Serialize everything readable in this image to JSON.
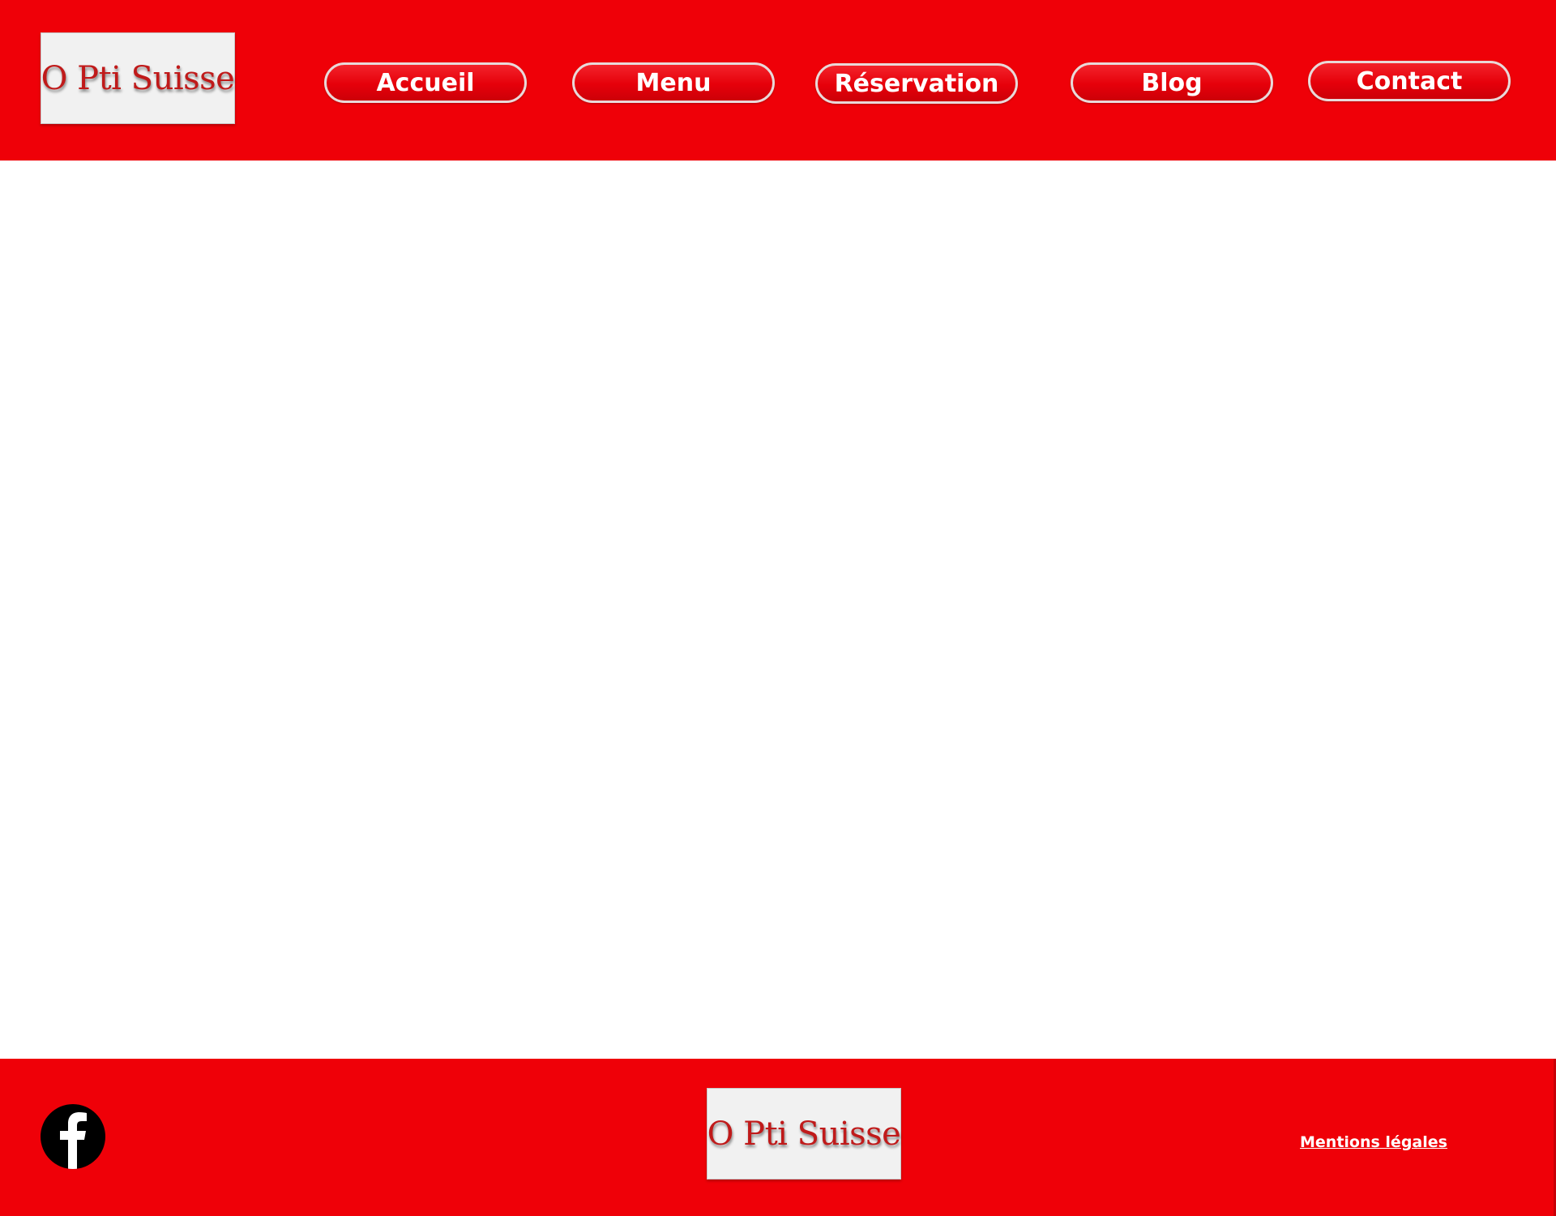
{
  "brand": {
    "name": "O Pti Suisse",
    "accent_color": "#ef0008",
    "logo_bg_color": "#f1f1f1",
    "logo_text_color": "#c01a1a"
  },
  "header": {
    "logo_text": "O Pti Suisse",
    "nav": [
      {
        "label": "Accueil"
      },
      {
        "label": "Menu"
      },
      {
        "label": "Réservation"
      },
      {
        "label": "Blog"
      },
      {
        "label": "Contact"
      }
    ]
  },
  "footer": {
    "logo_text": "O Pti Suisse",
    "social_icon": "facebook-icon",
    "legal_link": "Mentions légales"
  }
}
